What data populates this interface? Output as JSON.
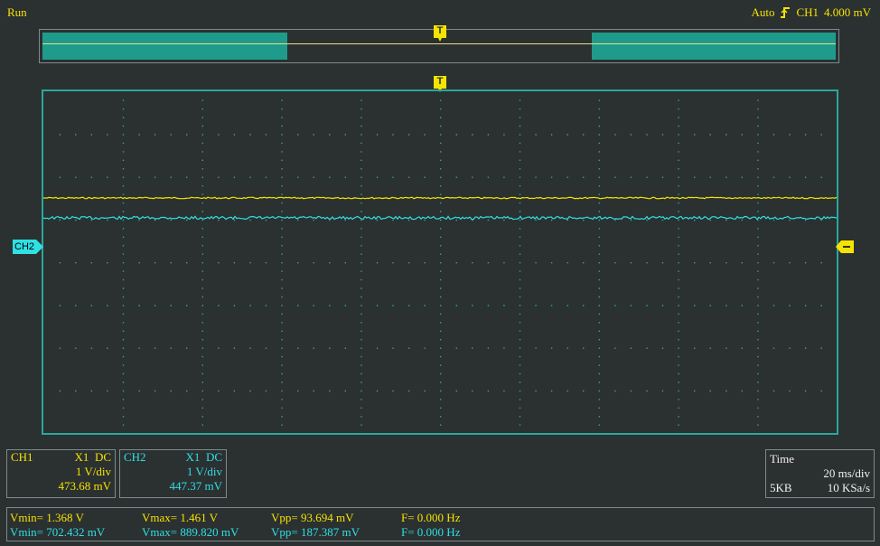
{
  "status": {
    "run_label": "Run"
  },
  "trigger": {
    "mode": "Auto",
    "edge_icon": "rising-edge-icon",
    "source": "CH1",
    "level": "4.000 mV"
  },
  "markers": {
    "trigger_top": "T",
    "trigger_grid": "T",
    "ch2_label": "CH2"
  },
  "ch1": {
    "name": "CH1",
    "probe": "X1",
    "coupling": "DC",
    "scale": "1 V/div",
    "offset": "473.68 mV"
  },
  "ch2": {
    "name": "CH2",
    "probe": "X1",
    "coupling": "DC",
    "scale": "1 V/div",
    "offset": "447.37 mV"
  },
  "time": {
    "label": "Time",
    "scale": "20 ms/div",
    "memory": "5KB",
    "sample_rate": "10 KSa/s"
  },
  "measurements": {
    "ch1": {
      "vmin": "Vmin= 1.368 V",
      "vmax": "Vmax= 1.461 V",
      "vpp": "Vpp= 93.694 mV",
      "freq": "F= 0.000 Hz"
    },
    "ch2": {
      "vmin": "Vmin= 702.432 mV",
      "vmax": "Vmax= 889.820 mV",
      "vpp": "Vpp= 187.387 mV",
      "freq": "F= 0.000 Hz"
    }
  },
  "colors": {
    "ch1": "#f5e400",
    "ch2": "#2fe0e4",
    "grid": "#2aa89b",
    "background": "#2b3031"
  }
}
